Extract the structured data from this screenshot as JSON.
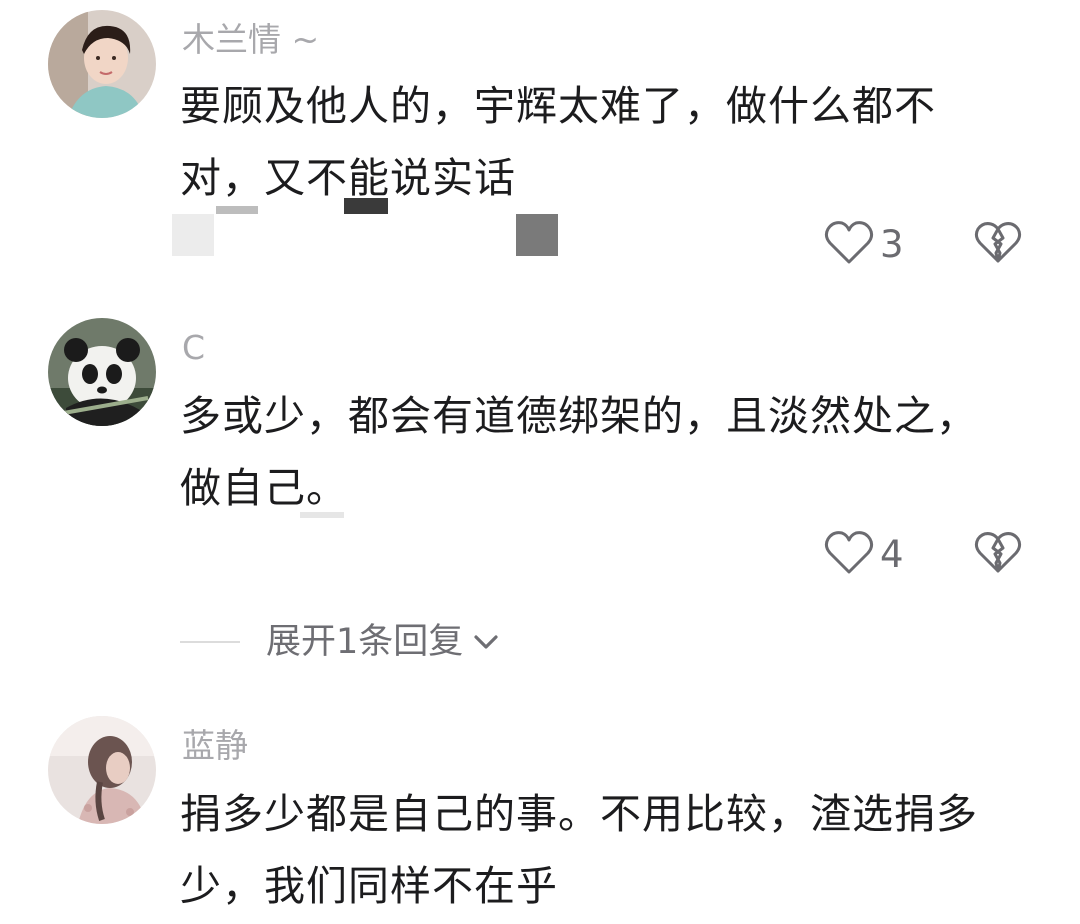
{
  "comments": [
    {
      "username": "木兰情 ~",
      "text": "要顾及他人的，宇辉太难了，做什么都不对，又不能说实话",
      "likes": "3"
    },
    {
      "username": "C",
      "text": "多或少，都会有道德绑架的，且淡然处之，做自己。",
      "likes": "4"
    },
    {
      "username": "蓝静",
      "text": "捐多少都是自己的事。不用比较，渣选捐多少，我们同样不在乎"
    }
  ],
  "reply": {
    "label": "展开1条回复"
  },
  "icons": {
    "like": "heart-outline-icon",
    "dislike": "broken-heart-icon",
    "expand": "chevron-down-icon"
  },
  "colors": {
    "username": "#a8a8ac",
    "text": "#1c1c1e",
    "icon": "#6b6b70"
  }
}
